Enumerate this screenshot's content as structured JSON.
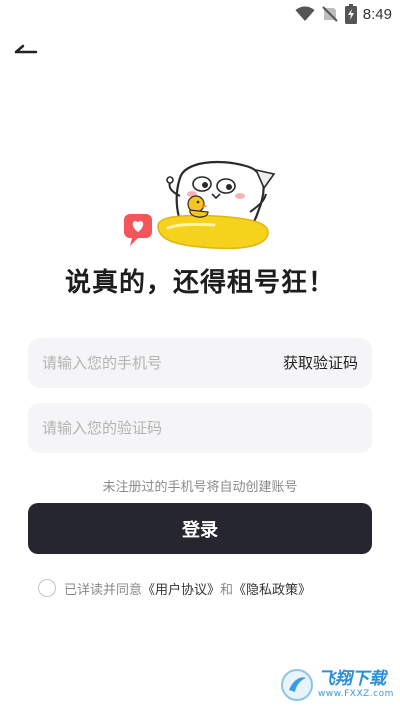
{
  "status_bar": {
    "time": "8:49",
    "icons": [
      "wifi-icon",
      "signal-off-icon",
      "battery-charging-icon"
    ]
  },
  "header": {
    "back_icon": "back-arrow-icon"
  },
  "hero": {
    "slogan": "说真的，还得租号狂！"
  },
  "form": {
    "phone_placeholder": "请输入您的手机号",
    "get_code_label": "获取验证码",
    "code_placeholder": "请输入您的验证码",
    "hint": "未注册过的手机号将自动创建账号",
    "login_label": "登录"
  },
  "agreement": {
    "prefix": "已详读并同意",
    "user_agreement": "《用户协议》",
    "and": "和",
    "privacy_policy": "《隐私政策》",
    "checked": false
  },
  "watermark": {
    "main": "飞翔下载",
    "sub": "www.FXXZ.com"
  },
  "colors": {
    "button_bg": "#26272e",
    "field_bg": "#f5f5f7",
    "mascot_ring": "#f5d21c",
    "heart": "#f2555a"
  }
}
